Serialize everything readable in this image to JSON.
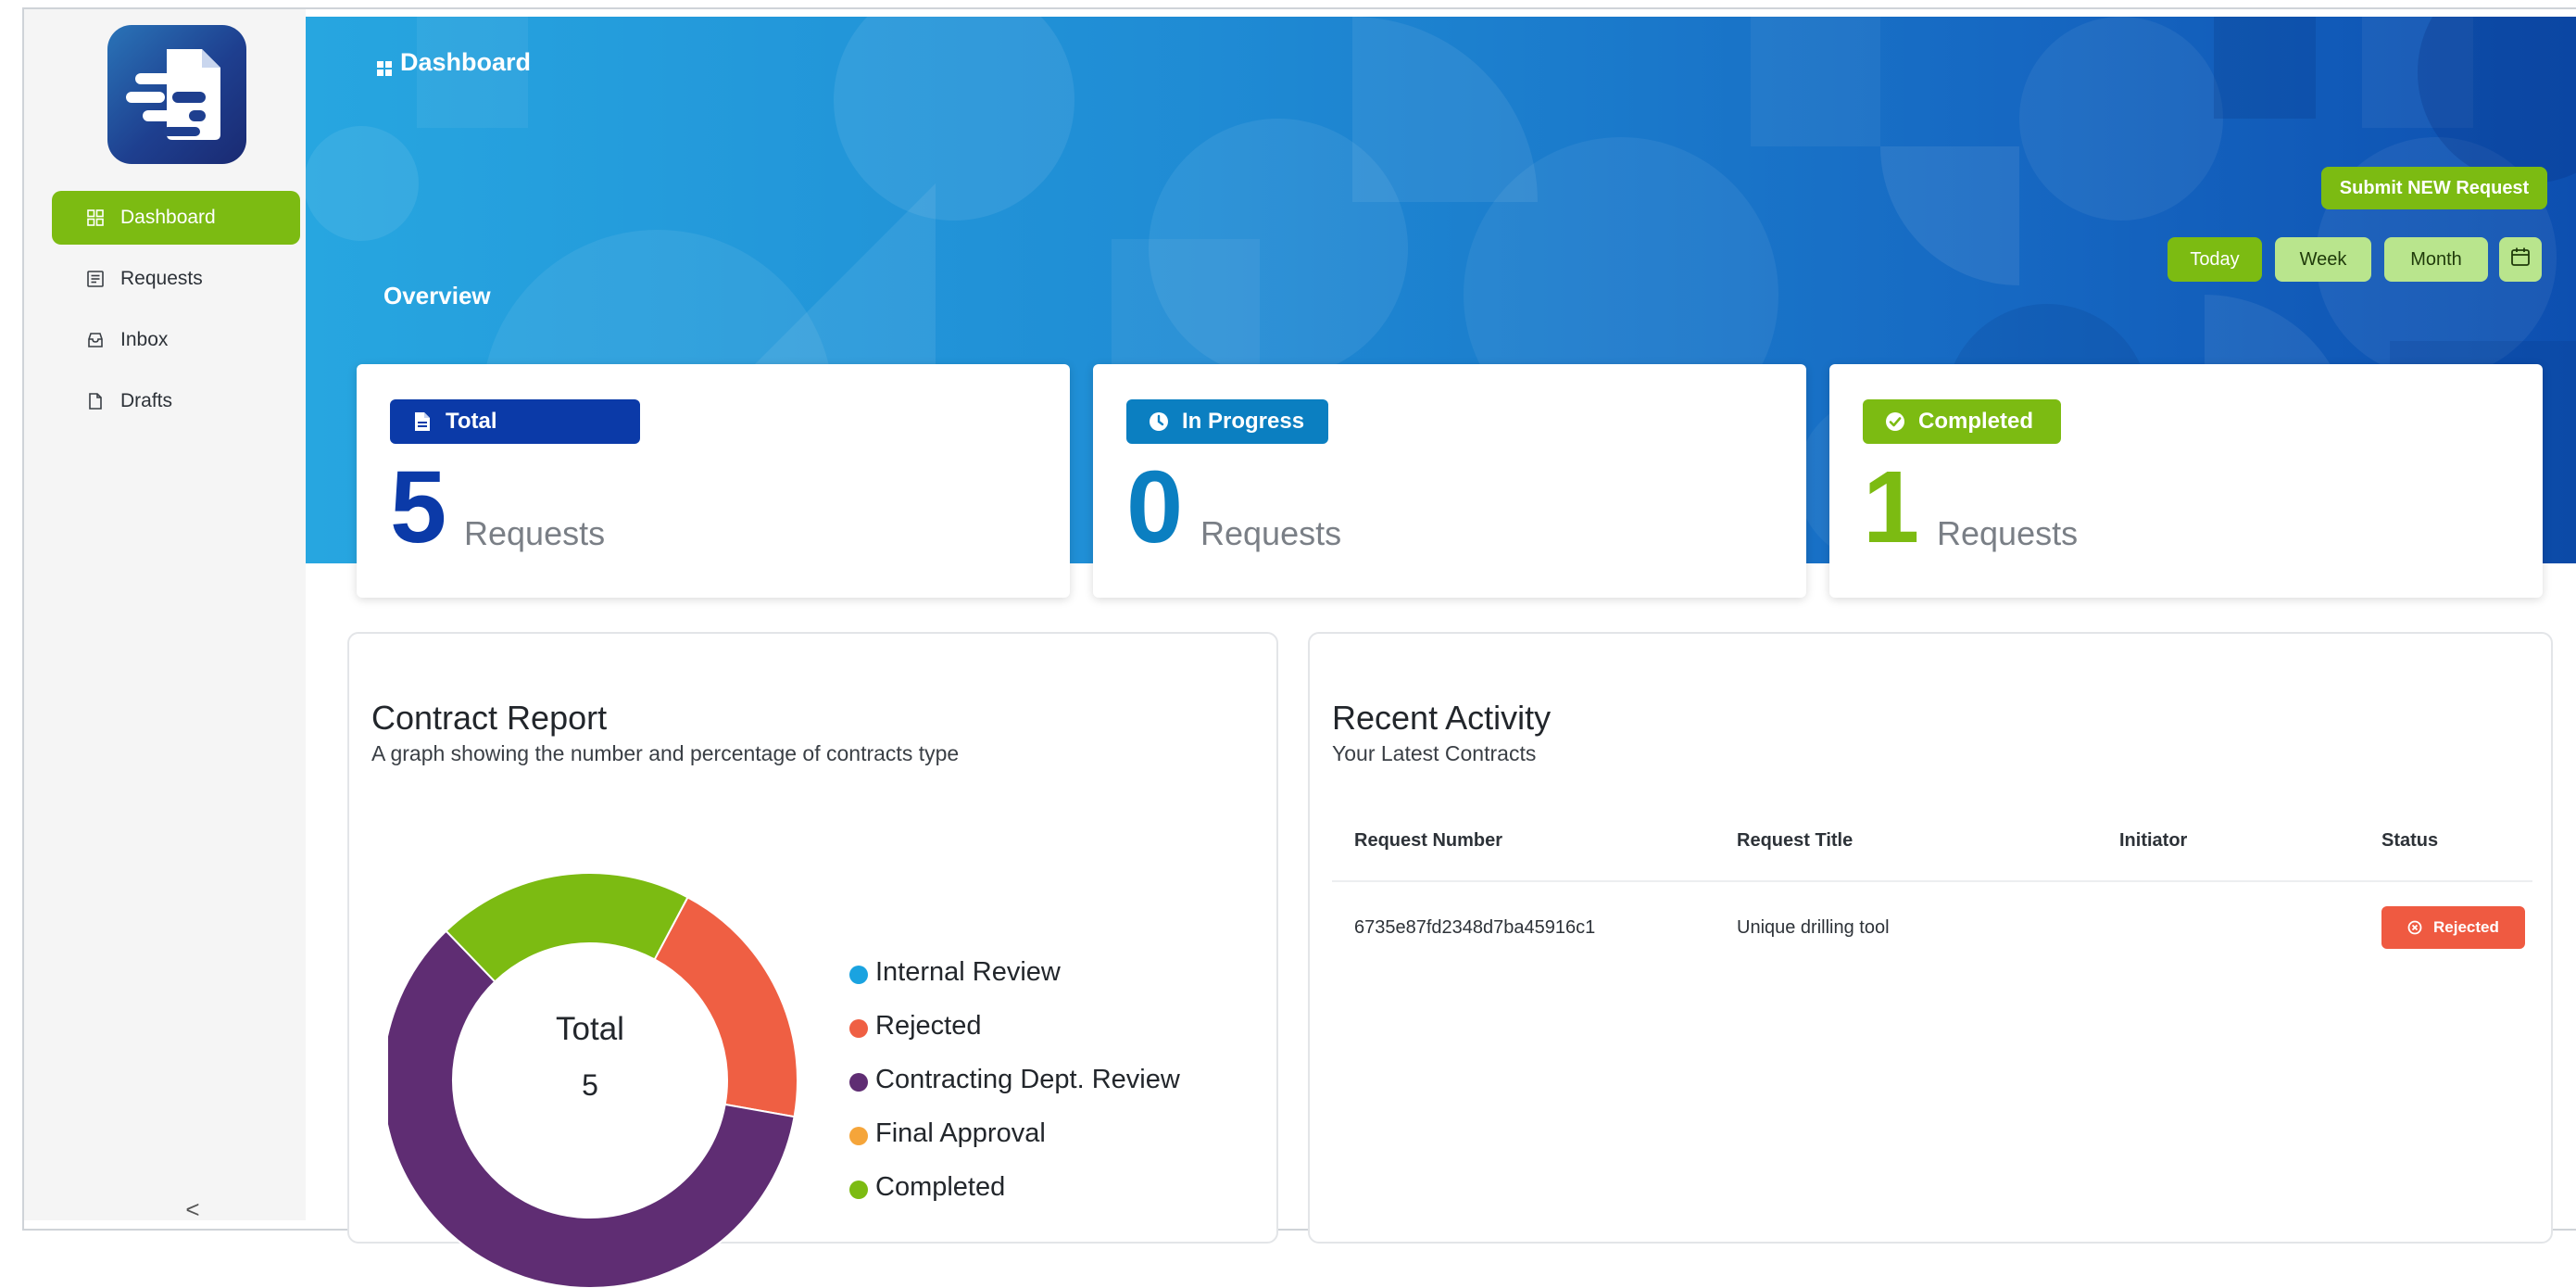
{
  "sidebar": {
    "items": [
      {
        "label": "Dashboard",
        "icon": "grid-icon",
        "active": true
      },
      {
        "label": "Requests",
        "icon": "list-icon",
        "active": false
      },
      {
        "label": "Inbox",
        "icon": "inbox-icon",
        "active": false
      },
      {
        "label": "Drafts",
        "icon": "file-icon",
        "active": false
      }
    ],
    "collapse_label": "<"
  },
  "header": {
    "title": "Dashboard",
    "overview": "Overview",
    "submit_label": "Submit NEW Request",
    "ranges": [
      {
        "label": "Today",
        "active": true
      },
      {
        "label": "Week",
        "active": false
      },
      {
        "label": "Month",
        "active": false
      }
    ]
  },
  "stats": [
    {
      "label": "Total",
      "value": "5",
      "unit": "Requests",
      "color": "#0b3aa8",
      "icon": "document-icon"
    },
    {
      "label": "In Progress",
      "value": "0",
      "unit": "Requests",
      "color": "#0b7fc1",
      "icon": "clock-icon"
    },
    {
      "label": "Completed",
      "value": "1",
      "unit": "Requests",
      "color": "#7cbb12",
      "icon": "check-circle-icon"
    }
  ],
  "report": {
    "title": "Contract Report",
    "subtitle": "A graph showing the number and percentage of contracts type",
    "center_label": "Total",
    "center_value": "5"
  },
  "chart_data": {
    "type": "pie",
    "variant": "donut",
    "categories": [
      "Internal Review",
      "Rejected",
      "Contracting Dept. Review",
      "Final Approval",
      "Completed"
    ],
    "values": [
      0,
      1,
      3,
      0,
      1
    ],
    "colors": [
      "#1aa3e0",
      "#ef5f43",
      "#5f2d73",
      "#f5a53a",
      "#7cbb12"
    ],
    "legend": "right"
  },
  "activity": {
    "title": "Recent Activity",
    "subtitle": "Your Latest Contracts",
    "columns": [
      "Request Number",
      "Request Title",
      "Initiator",
      "Status"
    ],
    "rows": [
      {
        "number": "6735e87fd2348d7ba45916c1",
        "title": "Unique drilling tool",
        "initiator": "",
        "status": "Rejected"
      }
    ]
  }
}
